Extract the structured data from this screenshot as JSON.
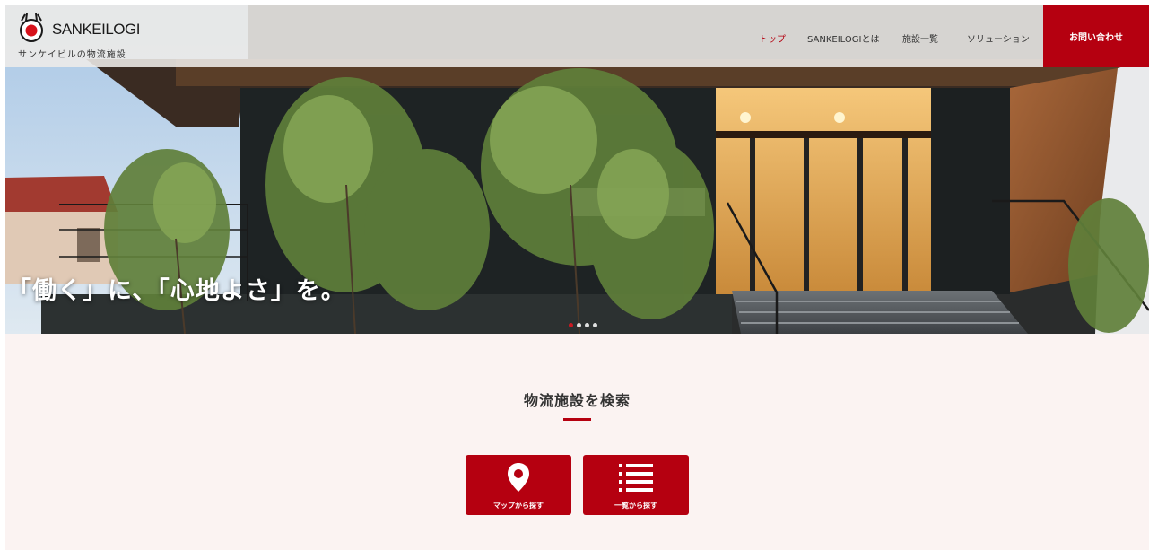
{
  "brand": {
    "name": "SANKEILOGI",
    "tagline": "サンケイビルの物流施設"
  },
  "nav": {
    "items": [
      {
        "label": "トップ",
        "active": true
      },
      {
        "label": "SANKEILOGIとは",
        "active": false
      },
      {
        "label": "施設一覧",
        "active": false
      },
      {
        "label": "ソリューション",
        "active": false
      }
    ],
    "contact_label": "お問い合わせ"
  },
  "hero": {
    "catchphrase": "「働く」に、「心地よさ」を。",
    "slides": 4,
    "active_slide": 1
  },
  "search": {
    "title": "物流施設を検索",
    "buttons": [
      {
        "label": "マップから探す",
        "icon": "map-pin-icon"
      },
      {
        "label": "一覧から探す",
        "icon": "list-icon"
      }
    ]
  },
  "colors": {
    "accent": "#b50010",
    "section_bg": "#fbf3f2"
  }
}
